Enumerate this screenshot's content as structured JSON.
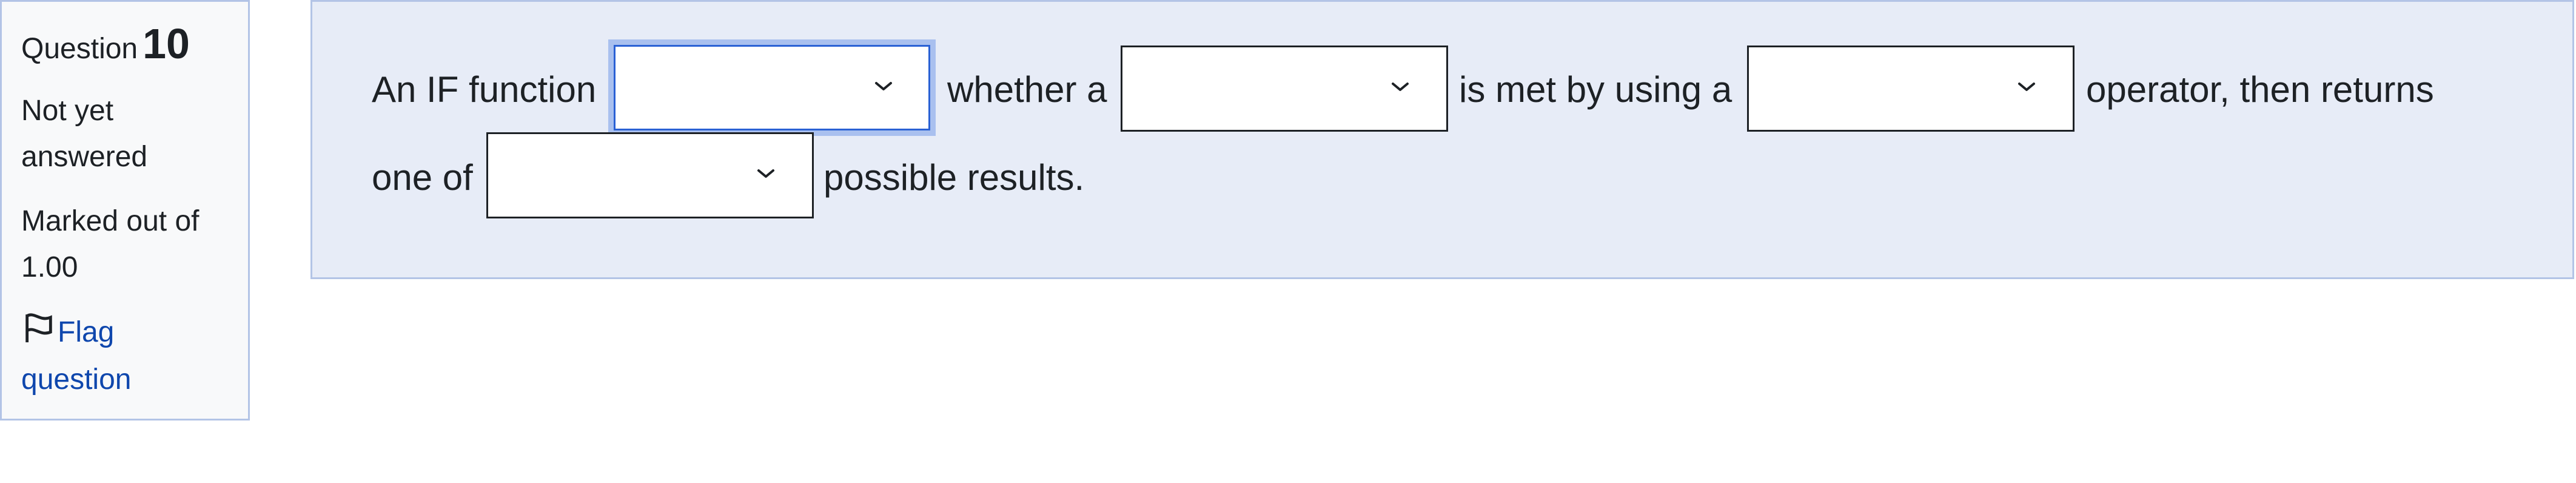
{
  "info": {
    "question_label": "Question",
    "question_number": "10",
    "state": "Not yet answered",
    "grade": "Marked out of 1.00",
    "flag_label": "Flag question"
  },
  "question": {
    "text": {
      "part1": "An IF function",
      "part2": "whether a",
      "part3": "is met by using a",
      "part4": "operator, then returns",
      "part5": "one of",
      "part6": "possible results."
    },
    "dropdowns": [
      {
        "selected": ""
      },
      {
        "selected": ""
      },
      {
        "selected": ""
      },
      {
        "selected": ""
      }
    ]
  },
  "colors": {
    "panel_border": "#b3c4e6",
    "info_background": "#f8f9fa",
    "content_background": "#e7ecf7",
    "link": "#0f47ad",
    "focus_ring": "#a9c0ef"
  },
  "icons": {
    "flag": "flag-icon",
    "dropdown": "chevron-down-icon"
  }
}
